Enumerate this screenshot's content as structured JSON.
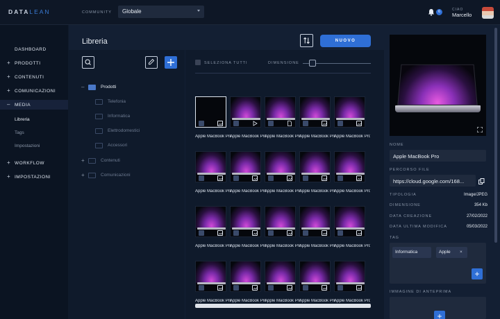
{
  "app": {
    "logo_part1": "DATA",
    "logo_part2": "LEAN"
  },
  "header": {
    "community_label": "COMMUNITY",
    "community_value": "Globale",
    "notifications_count": "6",
    "greeting": "CIAO",
    "user_name": "Marcello"
  },
  "sidebar": {
    "dashboard": "DASHBOARD",
    "prodotti": "PRODOTTI",
    "contenuti": "CONTENUTI",
    "comunicazioni": "COMUNICAZIONI",
    "media": "MEDIA",
    "media_sub": [
      "Libreria",
      "Tags",
      "Impostazioni"
    ],
    "workflow": "WORKFLOW",
    "impostazioni": "IMPOSTAZIONI",
    "plus": "+",
    "minus": "–"
  },
  "library": {
    "title": "Libreria",
    "new_label": "NUOVO",
    "select_all": "SELEZIONA TUTTI",
    "dimension_label": "DIMENSIONE",
    "dimension_value": 0.1
  },
  "tree": {
    "root": "Prodotti",
    "root_sign": "–",
    "children": [
      "Telefonia",
      "Informatica",
      "Elettrodomestici",
      "Accessori"
    ],
    "others": [
      "Contenuti",
      "Comunicazioni"
    ],
    "others_sign": "+"
  },
  "grid": {
    "caption": "Apple MacBook Pro",
    "rows": 4,
    "cols": 5
  },
  "detail": {
    "name_label": "NOME",
    "name_value": "Apple MacBook Pro",
    "path_label": "PERCORSO FILE",
    "path_value": "https://cloud.google.com/168...",
    "type_label": "TIPOLOGIA",
    "type_value": "Image/JPEG",
    "size_label": "DIMENSIONE",
    "size_value": "354 Kb",
    "created_label": "DATA CREAZIONE",
    "created_value": "27/02/2022",
    "modified_label": "DATA ULTIMA MODIFICA",
    "modified_value": "05/03/2022",
    "tag_label": "TAG",
    "tags": [
      "Informatica",
      "Apple"
    ],
    "tag_remove": "×",
    "preview_label": "IMMAGINE DI ANTEPRIMA",
    "plus": "+"
  }
}
